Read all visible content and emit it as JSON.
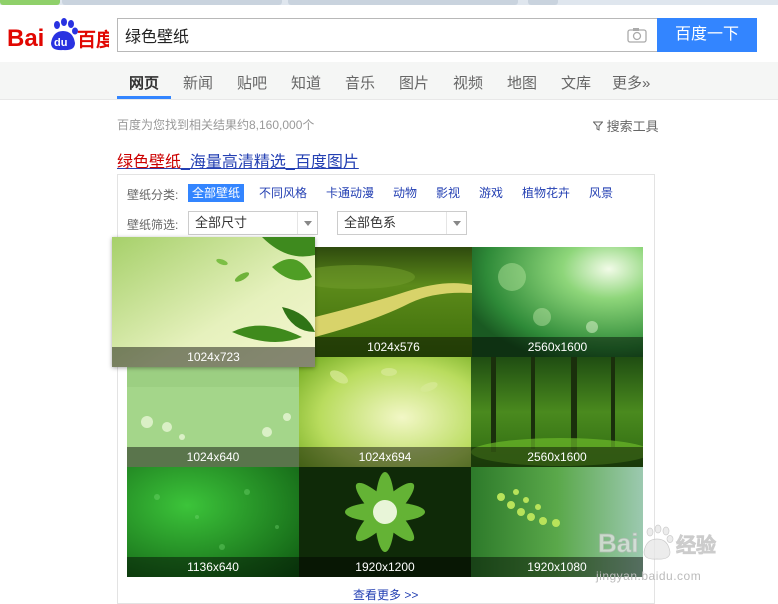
{
  "browser": {
    "tab_colors": [
      "#8fd06a",
      "#dcdcdc",
      "#dcdcdc",
      "#dcdcdc"
    ]
  },
  "logo": {
    "bai": "Bai",
    "du": "du",
    "cn": "百度"
  },
  "search": {
    "query": "绿色壁纸",
    "button": "百度一下",
    "camera_icon": "camera-icon"
  },
  "nav": {
    "items": [
      "网页",
      "新闻",
      "贴吧",
      "知道",
      "音乐",
      "图片",
      "视频",
      "地图",
      "文库",
      "更多»"
    ],
    "active_index": 0
  },
  "results": {
    "stats": "百度为您找到相关结果约8,160,000个",
    "tools": "搜索工具",
    "tools_icon": "funnel-icon",
    "title_highlight": "绿色壁纸",
    "title_rest": "_海量高清精选_百度图片"
  },
  "wallpaper": {
    "category_label": "壁纸分类:",
    "categories": [
      "全部壁纸",
      "不同风格",
      "卡通动漫",
      "动物",
      "影视",
      "游戏",
      "植物花卉",
      "风景"
    ],
    "active_category": 0,
    "filter_label": "壁纸筛选:",
    "size_select": "全部尺寸",
    "color_select": "全部色系",
    "images": [
      {
        "size": "1024x723",
        "scene": "leaves-corner"
      },
      {
        "size": "1024x576",
        "scene": "green-road"
      },
      {
        "size": "2560x1600",
        "scene": "bokeh-light"
      },
      {
        "size": "1024x640",
        "scene": "light-green-flowers"
      },
      {
        "size": "1024x694",
        "scene": "yellow-green-leaves"
      },
      {
        "size": "2560x1600",
        "scene": "forest"
      },
      {
        "size": "1136x640",
        "scene": "water-drops"
      },
      {
        "size": "1920x1200",
        "scene": "fractal-flower"
      },
      {
        "size": "1920x1080",
        "scene": "fern-macro"
      }
    ],
    "more": "查看更多 >>"
  },
  "watermark": {
    "brand": "Bai",
    "brand2": "经验",
    "url": "jingyan.baidu.com"
  },
  "colors": {
    "accent": "#3385ff",
    "link": "#2440b3",
    "highlight": "#c00000"
  }
}
